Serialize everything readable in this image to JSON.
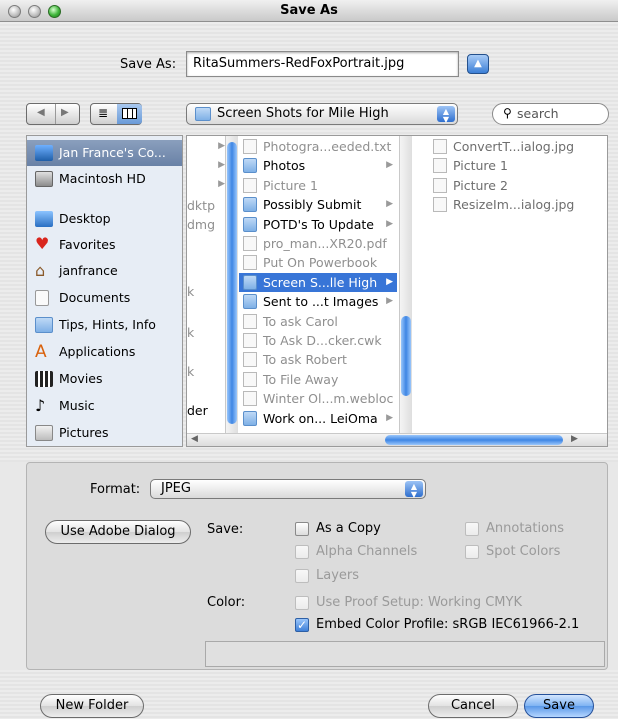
{
  "window": {
    "title": "Save As"
  },
  "save_as": {
    "label": "Save As:",
    "filename": "RitaSummers-RedFoxPortrait.jpg"
  },
  "toolbar": {
    "location": "Screen Shots for Mile High",
    "search_placeholder": "search"
  },
  "sidebar": {
    "items": [
      {
        "label": "Jan France's Co...",
        "icon": "computer-icon",
        "selected": true
      },
      {
        "label": "Macintosh HD",
        "icon": "hard-drive-icon"
      },
      {
        "label": "Desktop",
        "icon": "desktop-folder-icon"
      },
      {
        "label": "Favorites",
        "icon": "heart-icon"
      },
      {
        "label": "janfrance",
        "icon": "home-icon"
      },
      {
        "label": "Documents",
        "icon": "documents-icon"
      },
      {
        "label": "Tips, Hints, Info",
        "icon": "folder-icon"
      },
      {
        "label": "Applications",
        "icon": "applications-icon"
      },
      {
        "label": "Movies",
        "icon": "movies-icon"
      },
      {
        "label": "Music",
        "icon": "music-icon"
      },
      {
        "label": "Pictures",
        "icon": "pictures-icon"
      }
    ]
  },
  "columns": {
    "col0": [
      "dktp",
      "dmg",
      "k",
      "k",
      "k",
      "der"
    ],
    "col1": [
      {
        "label": "Photogra...eeded.txt",
        "kind": "doc",
        "dim": true
      },
      {
        "label": "Photos",
        "kind": "folder"
      },
      {
        "label": "Picture 1",
        "kind": "doc",
        "dim": true
      },
      {
        "label": "Possibly Submit",
        "kind": "folder"
      },
      {
        "label": "POTD's To Update",
        "kind": "folder"
      },
      {
        "label": "pro_man...XR20.pdf",
        "kind": "doc",
        "dim": true
      },
      {
        "label": "Put On Powerbook",
        "kind": "doc",
        "dim": true
      },
      {
        "label": "Screen S...lle High",
        "kind": "folder",
        "selected": true
      },
      {
        "label": "Sent to ...t Images",
        "kind": "folder"
      },
      {
        "label": "To ask Carol",
        "kind": "doc",
        "dim": true
      },
      {
        "label": "To Ask D...cker.cwk",
        "kind": "doc",
        "dim": true
      },
      {
        "label": "To ask Robert",
        "kind": "doc",
        "dim": true
      },
      {
        "label": "To File Away",
        "kind": "doc",
        "dim": true
      },
      {
        "label": "Winter Ol...m.webloc",
        "kind": "doc",
        "dim": true
      },
      {
        "label": "Work on... LeiOma",
        "kind": "folder"
      }
    ],
    "col2": [
      {
        "label": "ConvertT...ialog.jpg"
      },
      {
        "label": "Picture 1"
      },
      {
        "label": "Picture 2"
      },
      {
        "label": "ResizeIm...ialog.jpg"
      }
    ]
  },
  "options": {
    "format_label": "Format:",
    "format_value": "JPEG",
    "adobe_dialog_button": "Use Adobe Dialog",
    "save_label": "Save:",
    "as_a_copy": "As a Copy",
    "alpha_channels": "Alpha Channels",
    "layers": "Layers",
    "annotations": "Annotations",
    "spot_colors": "Spot Colors",
    "color_label": "Color:",
    "use_proof_setup": "Use Proof Setup:  Working CMYK",
    "embed_color_profile": "Embed Color Profile:  sRGB IEC61966-2.1",
    "embed_checked": true
  },
  "footer": {
    "new_folder": "New Folder",
    "cancel": "Cancel",
    "save": "Save"
  }
}
